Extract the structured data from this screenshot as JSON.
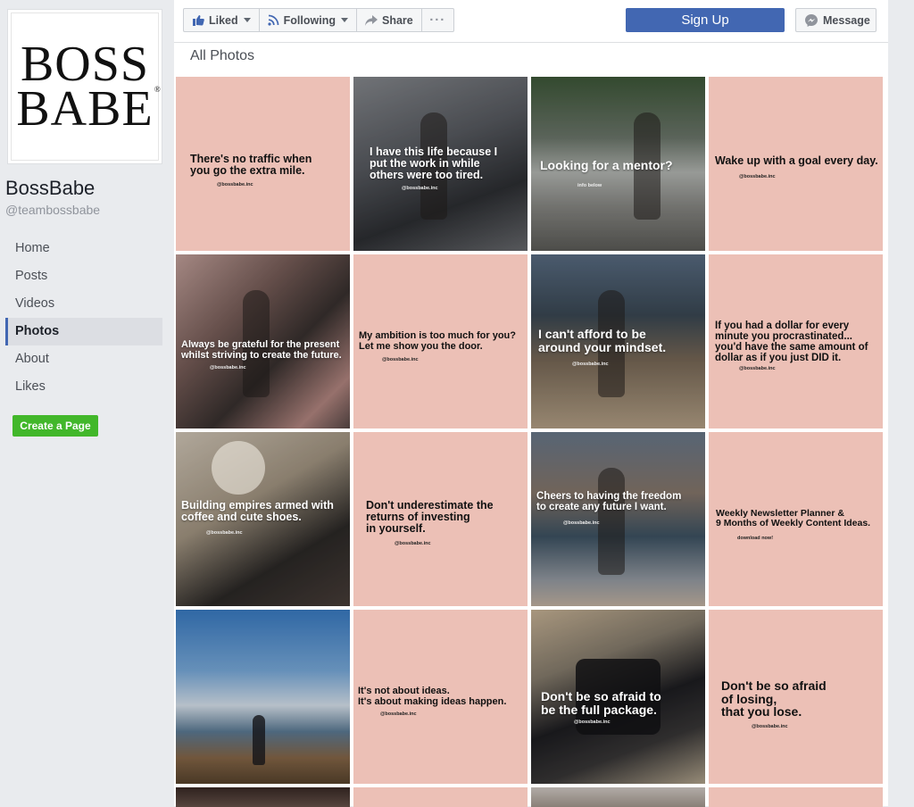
{
  "sidebar": {
    "logo": {
      "line1": "BOSS",
      "line2": "BABE",
      "reg": "®"
    },
    "page_name": "BossBabe",
    "handle": "@teambossbabe",
    "nav": [
      {
        "label": "Home"
      },
      {
        "label": "Posts"
      },
      {
        "label": "Videos"
      },
      {
        "label": "Photos",
        "active": true
      },
      {
        "label": "About"
      },
      {
        "label": "Likes"
      }
    ],
    "create_page": "Create a Page"
  },
  "toolbar": {
    "liked": "Liked",
    "following": "Following",
    "share": "Share",
    "more": "···",
    "sign_up": "Sign Up",
    "message": "Message"
  },
  "section_title": "All Photos",
  "colors": {
    "accent": "#4267b2",
    "create": "#42b72a",
    "pink": "#ecc0b6"
  },
  "photos": [
    {
      "quote": "There's no traffic when\nyou go the extra mile.",
      "handle": "@bossbabe.inc",
      "kind": "pink"
    },
    {
      "quote": "I have this life because I\nput the work in while\nothers were too tired.",
      "handle": "@bossbabe.inc",
      "kind": "photo-street"
    },
    {
      "quote": "Looking for a mentor?",
      "handle": "info below",
      "kind": "photo-car"
    },
    {
      "quote": "Wake up with a goal every day.",
      "handle": "@bossbabe.inc",
      "kind": "pink"
    },
    {
      "quote": "Always be grateful for the present\nwhilst striving to create the future.",
      "handle": "@bossbabe.inc",
      "kind": "photo-flowers"
    },
    {
      "quote": "My ambition is too much for you?\nLet me show you the door.",
      "handle": "@bossbabe.inc",
      "kind": "pink"
    },
    {
      "quote": "I can't afford to be\naround your mindset.",
      "handle": "@bossbabe.inc",
      "kind": "photo-beach"
    },
    {
      "quote": "If you had a dollar for every\nminute you procrastinated...\nyou'd have the same amount of\ndollar as if you just DID it.",
      "handle": "@bossbabe.inc",
      "kind": "pink"
    },
    {
      "quote": "Building empires armed with\ncoffee and cute shoes.",
      "handle": "@bossbabe.inc",
      "kind": "photo-coffee"
    },
    {
      "quote": "Don't underestimate the\nreturns of investing\nin yourself.",
      "handle": "@bossbabe.inc",
      "kind": "pink"
    },
    {
      "quote": "Cheers to having the freedom\nto create any future I want.",
      "handle": "@bossbabe.inc",
      "kind": "photo-canal"
    },
    {
      "quote": "Weekly Newsletter Planner &\n9 Months of Weekly Content Ideas.",
      "handle": "download now!",
      "kind": "pink"
    },
    {
      "quote": "",
      "handle": "",
      "kind": "photo-mountain"
    },
    {
      "quote": "It's not about ideas.\nIt's about making ideas happen.",
      "handle": "@bossbabe.inc",
      "kind": "pink"
    },
    {
      "quote": "Don't be so afraid to\nbe the full package.",
      "handle": "@bossbabe.inc",
      "kind": "photo-bag"
    },
    {
      "quote": "Don't be so afraid\nof losing,\nthat you lose.",
      "handle": "@bossbabe.inc",
      "kind": "pink"
    },
    {
      "quote": "",
      "handle": "",
      "kind": "photo-partial-dark"
    },
    {
      "quote": "",
      "handle": "",
      "kind": "pink"
    },
    {
      "quote": "",
      "handle": "",
      "kind": "photo-partial-light"
    },
    {
      "quote": "",
      "handle": "",
      "kind": "pink"
    }
  ]
}
